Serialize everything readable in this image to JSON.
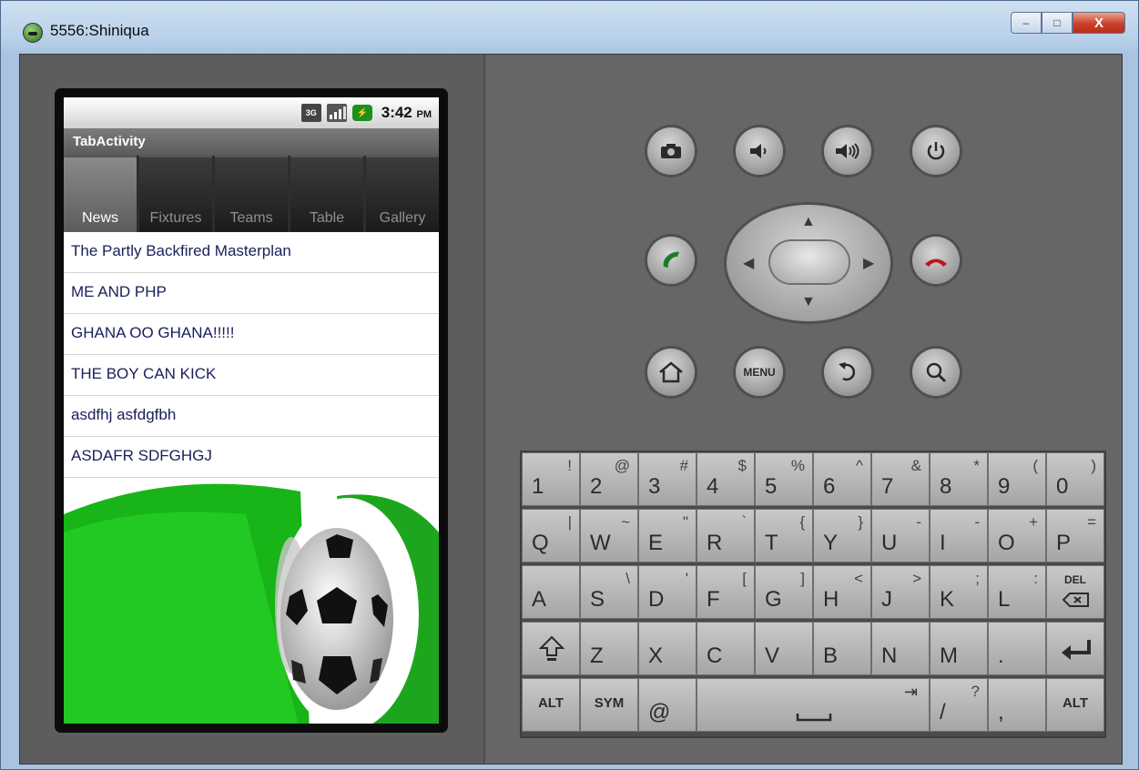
{
  "window": {
    "title": "5556:Shiniqua",
    "minimize": "–",
    "maximize": "□",
    "close": "X"
  },
  "statusbar": {
    "network": "3G",
    "time": "3:42",
    "ampm": "PM"
  },
  "app": {
    "title": "TabActivity"
  },
  "tabs": [
    "News",
    "Fixtures",
    "Teams",
    "Table",
    "Gallery"
  ],
  "news_items": [
    "The Partly Backfired Masterplan",
    "ME AND PHP",
    "GHANA OO GHANA!!!!!",
    "THE BOY CAN KICK",
    "asdfhj asfdgfbh",
    "ASDAFR SDFGHGJ"
  ],
  "controls": {
    "menu_label": "MENU"
  },
  "keyboard": {
    "row1": [
      [
        "1",
        "!"
      ],
      [
        "2",
        "@"
      ],
      [
        "3",
        "#"
      ],
      [
        "4",
        "$"
      ],
      [
        "5",
        "%"
      ],
      [
        "6",
        "^"
      ],
      [
        "7",
        "&"
      ],
      [
        "8",
        "*"
      ],
      [
        "9",
        "("
      ],
      [
        "0",
        ")"
      ]
    ],
    "row2": [
      [
        "Q",
        "|"
      ],
      [
        "W",
        "~"
      ],
      [
        "E",
        "\""
      ],
      [
        "R",
        "`"
      ],
      [
        "T",
        "{"
      ],
      [
        "Y",
        "}"
      ],
      [
        "U",
        "-"
      ],
      [
        "I",
        "-"
      ],
      [
        "O",
        "+"
      ],
      [
        "P",
        "="
      ]
    ],
    "row3": [
      [
        "A",
        ""
      ],
      [
        "S",
        "\\"
      ],
      [
        "D",
        "'"
      ],
      [
        "F",
        "["
      ],
      [
        "G",
        "]"
      ],
      [
        "H",
        "<"
      ],
      [
        "J",
        ">"
      ],
      [
        "K",
        ";"
      ],
      [
        "L",
        ":"
      ]
    ],
    "row4": [
      "Z",
      "X",
      "C",
      "V",
      "B",
      "N",
      "M",
      "."
    ],
    "del_label": "DEL",
    "alt_label": "ALT",
    "sym_label": "SYM",
    "at_label": "@",
    "slash": [
      "/",
      "?"
    ],
    "comma": ","
  }
}
